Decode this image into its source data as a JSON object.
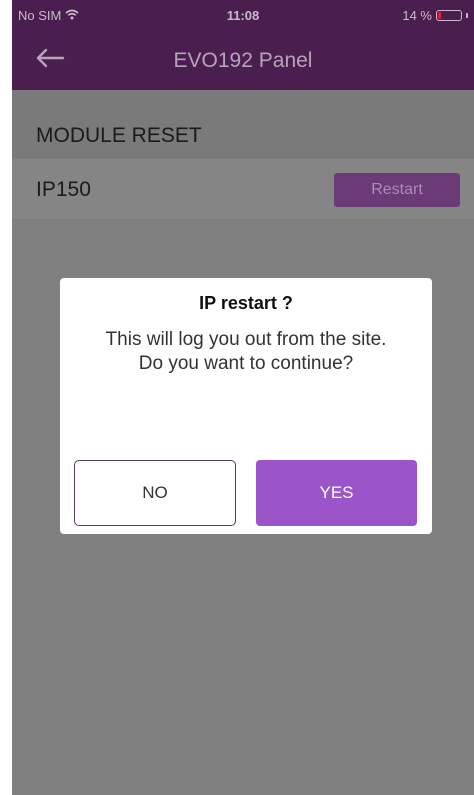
{
  "status_bar": {
    "carrier": "No SIM",
    "time": "11:08",
    "battery": "14 %",
    "battery_level": 0.14,
    "battery_color": "#e02040",
    "wifi_icon": "wifi-icon"
  },
  "nav": {
    "title": "EVO192 Panel",
    "back_icon": "back-arrow-icon",
    "background": "#4a1f4f"
  },
  "section": {
    "title": "MODULE RESET"
  },
  "module_row": {
    "label": "IP150",
    "button_label": "Restart"
  },
  "dialog": {
    "title": "IP restart ?",
    "message_line1": "This will log you out from the site.",
    "message_line2": "Do you want to continue?",
    "no_label": "NO",
    "yes_label": "YES",
    "accent": "#9b55c8"
  }
}
